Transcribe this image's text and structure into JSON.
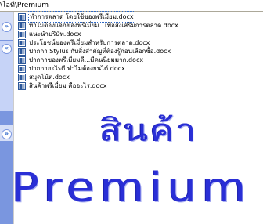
{
  "address": {
    "path": "\\ไอที\\Premium"
  },
  "taskpane": {
    "collapse_glyph": "»",
    "expand_glyph": "«"
  },
  "files": [
    {
      "name": "ทำการตลาด โดยใช้ของพรีเมี่ยม.docx",
      "selected": true
    },
    {
      "name": "ทำไมต้องแจกของพรีเมี่ยม...เพื่อส่งเสริมการตลาด.docx",
      "selected": false
    },
    {
      "name": "แนะนำบริษัท.docx",
      "selected": false
    },
    {
      "name": "ประโยชน์ของพรีเมี่ยมสำหรับการตลาด.docx",
      "selected": false
    },
    {
      "name": "ปากกา Stylus กับสิ่งสำคัญที่ต้องรู้ก่อนเลือกซื้อ.docx",
      "selected": false
    },
    {
      "name": "ปากกาของพรีเมี่ยมดี...มีคนนิยมมาก.docx",
      "selected": false
    },
    {
      "name": "ปากกาอะไรดี ทำไมต้องยนได้.docx",
      "selected": false
    },
    {
      "name": "สมุดโน้ต.docx",
      "selected": false
    },
    {
      "name": "สินค้าพรีเมี่ยม คืออะไร.docx",
      "selected": false
    }
  ],
  "wordart": {
    "line1": "สินค้า",
    "line2": "Premium"
  },
  "colors": {
    "wordart": "#2a2fd6",
    "taskpane": "#7a96df",
    "selection": "#316ac5"
  },
  "icons": {
    "file_icon": "word-document-icon"
  }
}
